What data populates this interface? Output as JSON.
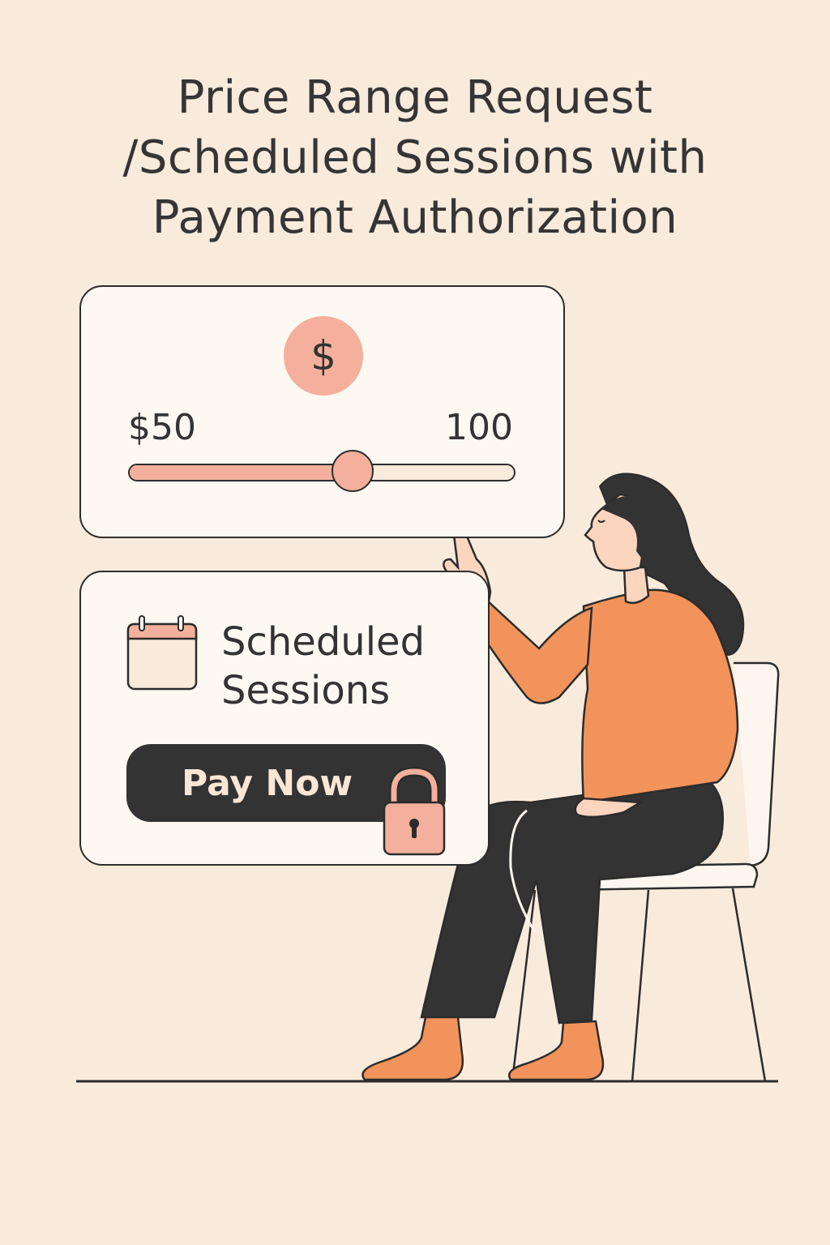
{
  "header": {
    "title_lines": [
      "Price Range Request",
      "/Scheduled Sessions with",
      "Payment Authorization"
    ]
  },
  "price_range": {
    "currency_icon": "dollar-icon",
    "currency_symbol": "$",
    "min_label": "$50",
    "max_label": "100",
    "slider_fraction": 0.58
  },
  "sessions": {
    "icon": "calendar-icon",
    "label_lines": [
      "Scheduled",
      "Sessions"
    ],
    "pay_button_label": "Pay Now",
    "lock_icon": "padlock-icon"
  },
  "colors": {
    "background": "#f8ebdc",
    "accent": "#f4b09c",
    "sweater": "#f2935b",
    "dark": "#333333"
  }
}
